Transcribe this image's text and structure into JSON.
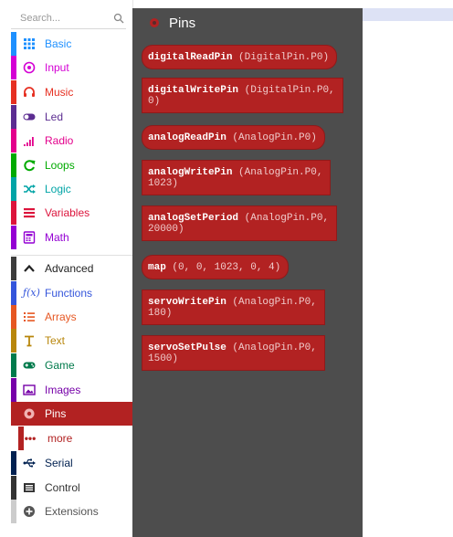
{
  "search": {
    "placeholder": "Search..."
  },
  "categories": [
    {
      "id": "basic",
      "label": "Basic",
      "icon": "grid-icon",
      "color": "#1e90ff"
    },
    {
      "id": "input",
      "label": "Input",
      "icon": "target-icon",
      "color": "#d400d4"
    },
    {
      "id": "music",
      "label": "Music",
      "icon": "headphones-icon",
      "color": "#e63022"
    },
    {
      "id": "led",
      "label": "Led",
      "icon": "toggle-icon",
      "color": "#5c2d91"
    },
    {
      "id": "radio",
      "label": "Radio",
      "icon": "signal-bars-icon",
      "color": "#e3008c"
    },
    {
      "id": "loops",
      "label": "Loops",
      "icon": "refresh-icon",
      "color": "#00aa00"
    },
    {
      "id": "logic",
      "label": "Logic",
      "icon": "shuffle-icon",
      "color": "#00a4a6"
    },
    {
      "id": "variables",
      "label": "Variables",
      "icon": "list-icon",
      "color": "#dc143c"
    },
    {
      "id": "math",
      "label": "Math",
      "icon": "calculator-icon",
      "color": "#9400d3"
    },
    {
      "id": "advanced",
      "label": "Advanced",
      "icon": "chevron-up-icon",
      "color": "#3c3c3c"
    },
    {
      "id": "functions",
      "label": "Functions",
      "icon": "function-icon",
      "color": "#3455db"
    },
    {
      "id": "arrays",
      "label": "Arrays",
      "icon": "list-ordered-icon",
      "color": "#e65722"
    },
    {
      "id": "text",
      "label": "Text",
      "icon": "text-cursor-icon",
      "color": "#b8860b"
    },
    {
      "id": "game",
      "label": "Game",
      "icon": "gamepad-icon",
      "color": "#007a4b"
    },
    {
      "id": "images",
      "label": "Images",
      "icon": "image-icon",
      "color": "#7600a8"
    },
    {
      "id": "pins",
      "label": "Pins",
      "icon": "pin-circle-icon",
      "color": "#b22222",
      "selected": true
    },
    {
      "id": "serial",
      "label": "Serial",
      "icon": "usb-icon",
      "color": "#002050"
    },
    {
      "id": "control",
      "label": "Control",
      "icon": "chip-icon",
      "color": "#333333"
    },
    {
      "id": "extensions",
      "label": "Extensions",
      "icon": "plus-circle-icon",
      "color": "#cccccc"
    }
  ],
  "subcategory": {
    "label": "more",
    "icon": "dots-icon",
    "color": "#b22222"
  },
  "flyout": {
    "title": "Pins",
    "blocks": [
      {
        "fn": "digitalReadPin",
        "args": " (DigitalPin.P0)",
        "shape": "rounded"
      },
      {
        "fn": "digitalWritePin",
        "args_line1": " (DigitalPin.P0,",
        "args_line2": "0)",
        "shape": "square"
      },
      {
        "fn": "analogReadPin",
        "args": " (AnalogPin.P0)",
        "shape": "rounded"
      },
      {
        "fn": "analogWritePin",
        "args_line1": " (AnalogPin.P0,",
        "args_line2": "1023)",
        "shape": "square"
      },
      {
        "fn": "analogSetPeriod",
        "args_line1": " (AnalogPin.P0,",
        "args_line2": "20000)",
        "shape": "square"
      },
      {
        "fn": "map",
        "args": " (0, 0, 1023, 0, 4)",
        "shape": "rounded"
      },
      {
        "fn": "servoWritePin",
        "args_line1": " (AnalogPin.P0,",
        "args_line2": "180)",
        "shape": "square"
      },
      {
        "fn": "servoSetPulse",
        "args_line1": " (AnalogPin.P0,",
        "args_line2": "1500)",
        "shape": "square"
      }
    ]
  }
}
